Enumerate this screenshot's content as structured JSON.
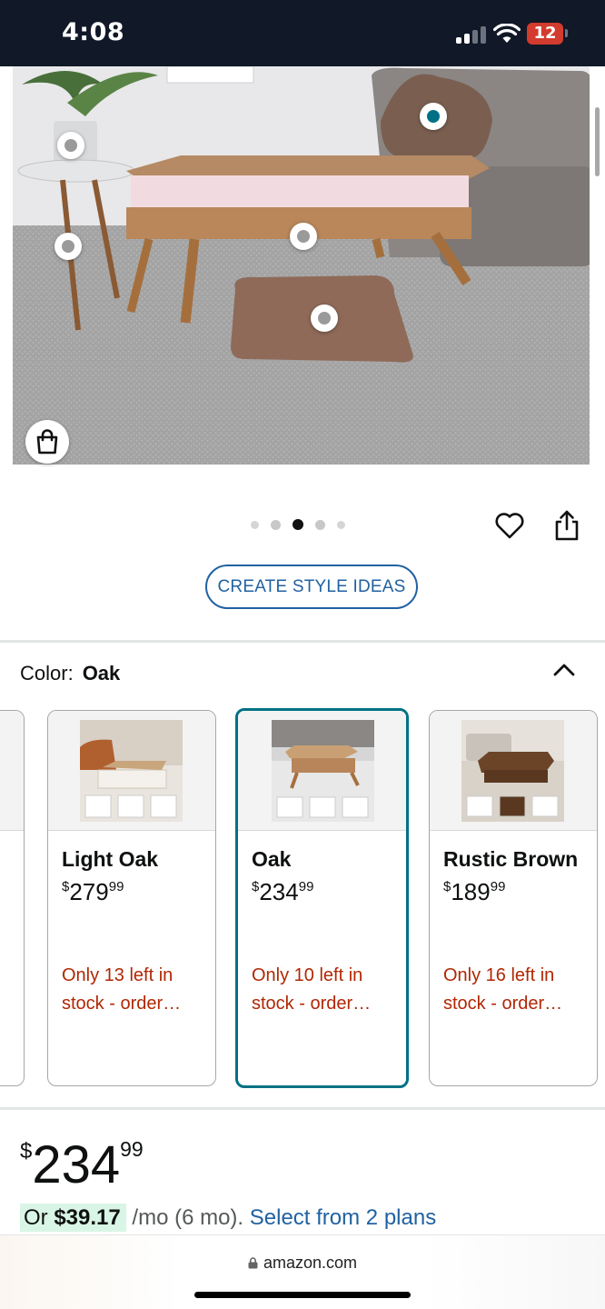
{
  "status_bar": {
    "time": "4:08",
    "battery": "12",
    "icons": [
      "signal-icon",
      "wifi-icon",
      "battery-icon"
    ]
  },
  "product_image": {
    "hotspot_count": 5,
    "carousel": {
      "total": 5,
      "current": 3
    },
    "icons": [
      "shopping-bag-icon",
      "heart-icon",
      "share-icon"
    ]
  },
  "create_style_ideas_label": "CREATE STYLE IDEAS",
  "color_selector": {
    "label": "Color:",
    "selected": "Oak",
    "collapse_icon": "chevron-up-icon",
    "swatches": [
      {
        "name": "Light Oak",
        "price_symbol": "$",
        "price_whole": "279",
        "price_fraction": "99",
        "stock_line1": "Only 13 left in",
        "stock_line2": "stock - order…",
        "selected": false
      },
      {
        "name": "Oak",
        "price_symbol": "$",
        "price_whole": "234",
        "price_fraction": "99",
        "stock_line1": "Only 10 left in",
        "stock_line2": "stock - order…",
        "selected": true
      },
      {
        "name": "Rustic Brown",
        "price_symbol": "$",
        "price_whole": "189",
        "price_fraction": "99",
        "stock_line1": "Only 16 left in",
        "stock_line2": "stock - order…",
        "selected": false
      }
    ]
  },
  "price": {
    "symbol": "$",
    "whole": "234",
    "fraction": "99"
  },
  "installment": {
    "prefix": "Or ",
    "amount": "$39.17",
    "term": " /mo (6 mo).",
    "link": "Select from 2 plans"
  },
  "browser": {
    "url": "amazon.com"
  },
  "colors": {
    "selected_border": "#007185",
    "link": "#2162a1",
    "stock_warning": "#b12704",
    "installment_highlight": "#d9f5e6"
  }
}
